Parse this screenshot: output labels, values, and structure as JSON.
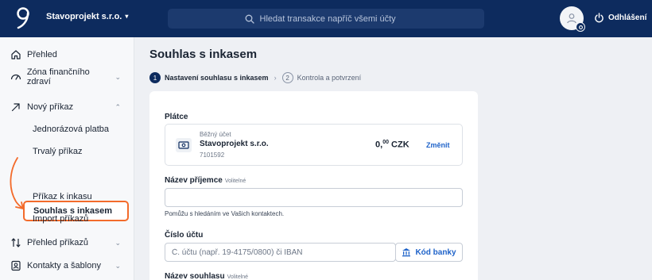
{
  "header": {
    "company": "Stavoprojekt s.r.o.",
    "search_placeholder": "Hledat transakce napříč všemi účty",
    "logout_label": "Odhlášení"
  },
  "sidebar": {
    "items": [
      {
        "label": "Přehled",
        "icon": "home-icon"
      },
      {
        "label": "Zóna finančního zdraví",
        "icon": "gauge-icon"
      },
      {
        "label": "Nový příkaz",
        "icon": "arrow-up-right-icon"
      },
      {
        "label": "Přehled příkazů",
        "icon": "swap-arrows-icon"
      },
      {
        "label": "Kontakty a šablony",
        "icon": "contacts-icon"
      }
    ],
    "subitems": [
      "Jednorázová platba",
      "Trvalý příkaz",
      "Souhlas s inkasem",
      "Příkaz k inkasu",
      "Import příkazů"
    ],
    "active_subitem": "Souhlas s inkasem",
    "highlight_color": "#f36b2b"
  },
  "main": {
    "title": "Souhlas s inkasem",
    "steps": [
      {
        "num": "1",
        "label": "Nastavení souhlasu s inkasem"
      },
      {
        "num": "2",
        "label": "Kontrola a potvrzení"
      }
    ]
  },
  "form": {
    "payer_label": "Plátce",
    "account": {
      "type": "Běžný účet",
      "name": "Stavoprojekt s.r.o.",
      "number": "7101592",
      "balance_main": "0,",
      "balance_dec": "00",
      "currency": "CZK",
      "change_label": "Změnit"
    },
    "recipient_label": "Název příjemce",
    "optional_label": "Volitelné",
    "recipient_value": "",
    "recipient_hint": "Pomůžu s hledáním ve Vašich kontaktech.",
    "account_label": "Číslo účtu",
    "account_placeholder": "Č. účtu (např. 19-4175/0800) či IBAN",
    "bank_code_label": "Kód banky",
    "consent_name_label": "Název souhlasu",
    "consent_optional_label": "Volitelné"
  }
}
